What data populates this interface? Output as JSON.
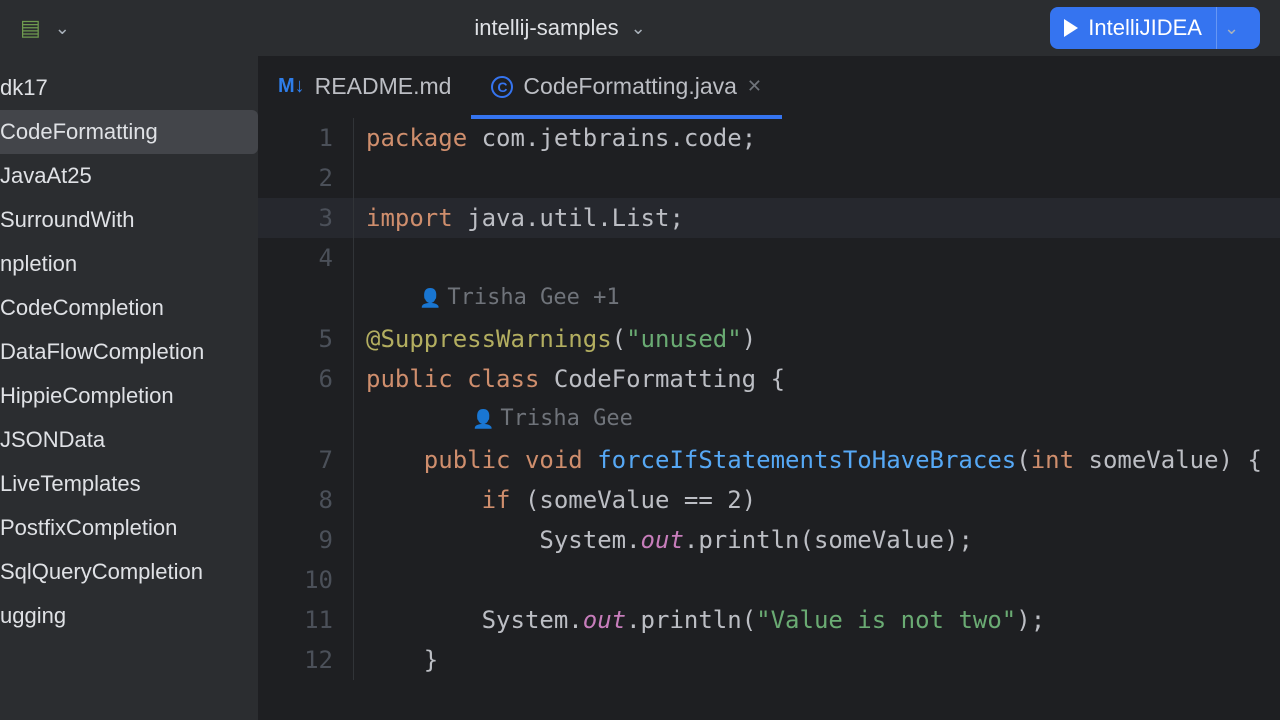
{
  "project": {
    "name": "intellij-samples"
  },
  "run_config": {
    "label": "IntelliJIDEA"
  },
  "sidebar": {
    "items": [
      "dk17",
      "CodeFormatting",
      "JavaAt25",
      "SurroundWith",
      "npletion",
      "CodeCompletion",
      "DataFlowCompletion",
      "HippieCompletion",
      "JSONData",
      "LiveTemplates",
      "PostfixCompletion",
      "SqlQueryCompletion",
      "ugging"
    ],
    "selected_index": 1
  },
  "tabs": [
    {
      "icon": "markdown",
      "label": "README.md",
      "active": false,
      "closeable": false
    },
    {
      "icon": "class",
      "label": "CodeFormatting.java",
      "active": true,
      "closeable": true
    }
  ],
  "annotations": {
    "class_author": "Trisha Gee +1",
    "method_author": "Trisha Gee"
  },
  "code": {
    "lines": [
      {
        "n": 1,
        "tokens": [
          [
            "kw",
            "package"
          ],
          [
            "pln",
            " com.jetbrains.code;"
          ]
        ]
      },
      {
        "n": 2,
        "tokens": []
      },
      {
        "n": 3,
        "current": true,
        "tokens": [
          [
            "kw",
            "import"
          ],
          [
            "pln",
            " java.util.List;"
          ]
        ]
      },
      {
        "n": 4,
        "tokens": []
      },
      {
        "hint": "class_author",
        "indent": 1
      },
      {
        "n": 5,
        "tokens": [
          [
            "ann",
            "@SuppressWarnings"
          ],
          [
            "pln",
            "("
          ],
          [
            "str",
            "\"unused\""
          ],
          [
            "pln",
            ")"
          ]
        ]
      },
      {
        "n": 6,
        "tokens": [
          [
            "kw",
            "public class"
          ],
          [
            "pln",
            " CodeFormatting {"
          ]
        ]
      },
      {
        "hint": "method_author",
        "indent": 2
      },
      {
        "n": 7,
        "tokens": [
          [
            "pln",
            "    "
          ],
          [
            "kw",
            "public void"
          ],
          [
            "pln",
            " "
          ],
          [
            "mtd",
            "forceIfStatementsToHaveBraces"
          ],
          [
            "pln",
            "("
          ],
          [
            "kw",
            "int"
          ],
          [
            "pln",
            " someValue) {"
          ]
        ]
      },
      {
        "n": 8,
        "tokens": [
          [
            "pln",
            "        "
          ],
          [
            "kw",
            "if"
          ],
          [
            "pln",
            " (someValue == "
          ],
          [
            "pln",
            "2"
          ],
          [
            "pln",
            ")"
          ]
        ]
      },
      {
        "n": 9,
        "tokens": [
          [
            "pln",
            "            System."
          ],
          [
            "fld",
            "out"
          ],
          [
            "pln",
            ".println(someValue);"
          ]
        ]
      },
      {
        "n": 10,
        "tokens": []
      },
      {
        "n": 11,
        "tokens": [
          [
            "pln",
            "        System."
          ],
          [
            "fld",
            "out"
          ],
          [
            "pln",
            ".println("
          ],
          [
            "str",
            "\"Value is not two\""
          ],
          [
            "pln",
            ");"
          ]
        ]
      },
      {
        "n": 12,
        "tokens": [
          [
            "pln",
            "    }"
          ]
        ]
      }
    ]
  }
}
